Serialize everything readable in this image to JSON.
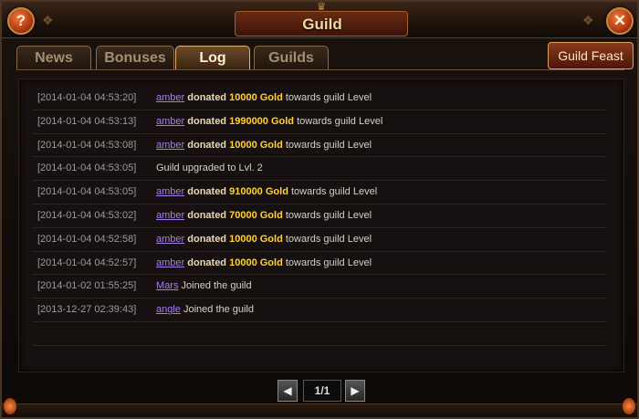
{
  "window": {
    "title": "Guild",
    "help_glyph": "?",
    "close_glyph": "✕"
  },
  "tabs": [
    {
      "label": "News",
      "active": false
    },
    {
      "label": "Bonuses",
      "active": false
    },
    {
      "label": "Log",
      "active": true
    },
    {
      "label": "Guilds",
      "active": false
    }
  ],
  "feast_button": {
    "label": "Guild Feast"
  },
  "log": [
    {
      "timestamp": "[2014-01-04 04:53:20]",
      "name": "amber",
      "verb": "donated",
      "amount": "10000 Gold",
      "rest": "towards guild Level"
    },
    {
      "timestamp": "[2014-01-04 04:53:13]",
      "name": "amber",
      "verb": "donated",
      "amount": "1990000 Gold",
      "rest": "towards guild Level"
    },
    {
      "timestamp": "[2014-01-04 04:53:08]",
      "name": "amber",
      "verb": "donated",
      "amount": "10000 Gold",
      "rest": "towards guild Level"
    },
    {
      "timestamp": "[2014-01-04 04:53:05]",
      "name": "",
      "verb": "",
      "amount": "",
      "rest": "Guild upgraded to Lvl. 2"
    },
    {
      "timestamp": "[2014-01-04 04:53:05]",
      "name": "amber",
      "verb": "donated",
      "amount": "910000 Gold",
      "rest": "towards guild Level"
    },
    {
      "timestamp": "[2014-01-04 04:53:02]",
      "name": "amber",
      "verb": "donated",
      "amount": "70000 Gold",
      "rest": "towards guild Level"
    },
    {
      "timestamp": "[2014-01-04 04:52:58]",
      "name": "amber",
      "verb": "donated",
      "amount": "10000 Gold",
      "rest": "towards guild Level"
    },
    {
      "timestamp": "[2014-01-04 04:52:57]",
      "name": "amber",
      "verb": "donated",
      "amount": "10000 Gold",
      "rest": "towards guild Level"
    },
    {
      "timestamp": "[2014-01-02 01:55:25]",
      "name": "Mars",
      "verb": "",
      "amount": "",
      "rest": "Joined the guild"
    },
    {
      "timestamp": "[2013-12-27 02:39:43]",
      "name": "angle",
      "verb": "",
      "amount": "",
      "rest": "Joined the guild"
    }
  ],
  "pager": {
    "display": "1/1",
    "prev_icon": "triangle-left-icon",
    "next_icon": "triangle-right-icon"
  },
  "colors": {
    "name_link": "#a67cf0",
    "gold_amount": "#ffd23a",
    "timestamp": "#9a9a9a"
  }
}
